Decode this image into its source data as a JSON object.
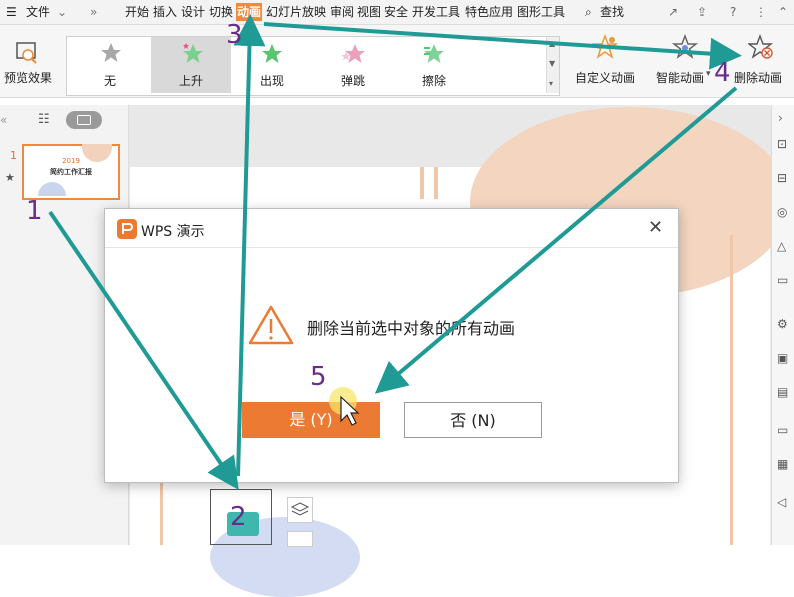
{
  "menubar": {
    "file_label": "文件",
    "tabs": [
      "开始",
      "插入",
      "设计",
      "切换",
      "动画",
      "幻灯片放映",
      "审阅",
      "视图",
      "安全",
      "开发工具",
      "特色应用",
      "图形工具"
    ],
    "active_tab_index": 4,
    "search_label": "查找"
  },
  "ribbon": {
    "preview_label": "预览效果",
    "effects": [
      {
        "label": "无",
        "icon": "star-gray-icon"
      },
      {
        "label": "上升",
        "icon": "star-green-rise-icon"
      },
      {
        "label": "出现",
        "icon": "star-green-icon"
      },
      {
        "label": "弹跳",
        "icon": "star-bounce-icon"
      },
      {
        "label": "擦除",
        "icon": "star-wipe-icon"
      }
    ],
    "selected_effect_index": 1,
    "custom_label": "自定义动画",
    "smart_label": "智能动画",
    "delete_label": "删除动画"
  },
  "slide_panel": {
    "slide_number": "1",
    "thumb_year": "2019",
    "thumb_title": "简约工作汇报"
  },
  "dialog": {
    "title": "WPS 演示",
    "message": "删除当前选中对象的所有动画",
    "yes_label": "是 (Y)",
    "no_label": "否 (N)"
  },
  "annotations": [
    "1",
    "2",
    "3",
    "4",
    "5"
  ],
  "colors": {
    "accent": "#f08a3a",
    "primary_button": "#ec7a33",
    "arrow": "#1f9a94",
    "step_number": "#6a2c8a"
  }
}
